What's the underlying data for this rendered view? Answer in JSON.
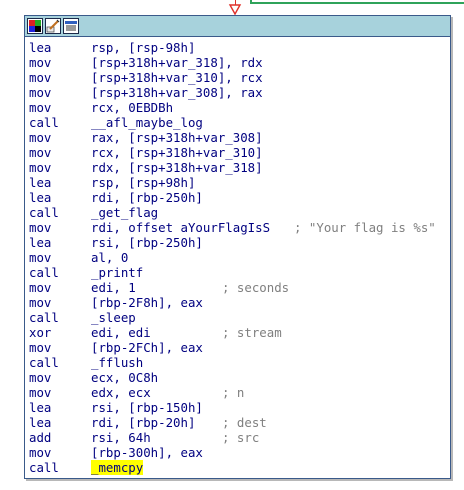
{
  "header": {
    "icons": [
      "graph-color-icon",
      "edit-node-icon",
      "node-list-icon"
    ]
  },
  "colors": {
    "header_bg": "#a7d2dc",
    "code_text": "#000080",
    "comment_text": "#808080",
    "highlight": "#ffff00",
    "edge_red": "#e0302a",
    "edge_green": "#2fa35a"
  },
  "lines": [
    {
      "mnemonic": "lea",
      "operands": "rsp, [rsp-98h]",
      "comment": ""
    },
    {
      "mnemonic": "mov",
      "operands": "[rsp+318h+var_318], rdx",
      "comment": ""
    },
    {
      "mnemonic": "mov",
      "operands": "[rsp+318h+var_310], rcx",
      "comment": ""
    },
    {
      "mnemonic": "mov",
      "operands": "[rsp+318h+var_308], rax",
      "comment": ""
    },
    {
      "mnemonic": "mov",
      "operands": "rcx, 0EBDBh",
      "comment": ""
    },
    {
      "mnemonic": "call",
      "operands": "__afl_maybe_log",
      "comment": ""
    },
    {
      "mnemonic": "mov",
      "operands": "rax, [rsp+318h+var_308]",
      "comment": ""
    },
    {
      "mnemonic": "mov",
      "operands": "rcx, [rsp+318h+var_310]",
      "comment": ""
    },
    {
      "mnemonic": "mov",
      "operands": "rdx, [rsp+318h+var_318]",
      "comment": ""
    },
    {
      "mnemonic": "lea",
      "operands": "rsp, [rsp+98h]",
      "comment": ""
    },
    {
      "mnemonic": "lea",
      "operands": "rdi, [rbp-250h]",
      "comment": ""
    },
    {
      "mnemonic": "call",
      "operands": "_get_flag",
      "comment": ""
    },
    {
      "mnemonic": "mov",
      "operands": "rdi, offset aYourFlagIsS",
      "comment": "; \"Your flag is %s\""
    },
    {
      "mnemonic": "lea",
      "operands": "rsi, [rbp-250h]",
      "comment": ""
    },
    {
      "mnemonic": "mov",
      "operands": "al, 0",
      "comment": ""
    },
    {
      "mnemonic": "call",
      "operands": "_printf",
      "comment": ""
    },
    {
      "mnemonic": "mov",
      "operands": "edi, 1",
      "comment": "; seconds"
    },
    {
      "mnemonic": "mov",
      "operands": "[rbp-2F8h], eax",
      "comment": ""
    },
    {
      "mnemonic": "call",
      "operands": "_sleep",
      "comment": ""
    },
    {
      "mnemonic": "xor",
      "operands": "edi, edi",
      "comment": "; stream"
    },
    {
      "mnemonic": "mov",
      "operands": "[rbp-2FCh], eax",
      "comment": ""
    },
    {
      "mnemonic": "call",
      "operands": "_fflush",
      "comment": ""
    },
    {
      "mnemonic": "mov",
      "operands": "ecx, 0C8h",
      "comment": ""
    },
    {
      "mnemonic": "mov",
      "operands": "edx, ecx",
      "comment": "; n"
    },
    {
      "mnemonic": "lea",
      "operands": "rsi, [rbp-150h]",
      "comment": ""
    },
    {
      "mnemonic": "lea",
      "operands": "rdi, [rbp-20h]",
      "comment": "; dest"
    },
    {
      "mnemonic": "add",
      "operands": "rsi, 64h",
      "comment": "; src"
    },
    {
      "mnemonic": "mov",
      "operands": "[rbp-300h], eax",
      "comment": ""
    },
    {
      "mnemonic": "call",
      "operands": "_memcpy",
      "comment": "",
      "highlighted": true
    }
  ]
}
